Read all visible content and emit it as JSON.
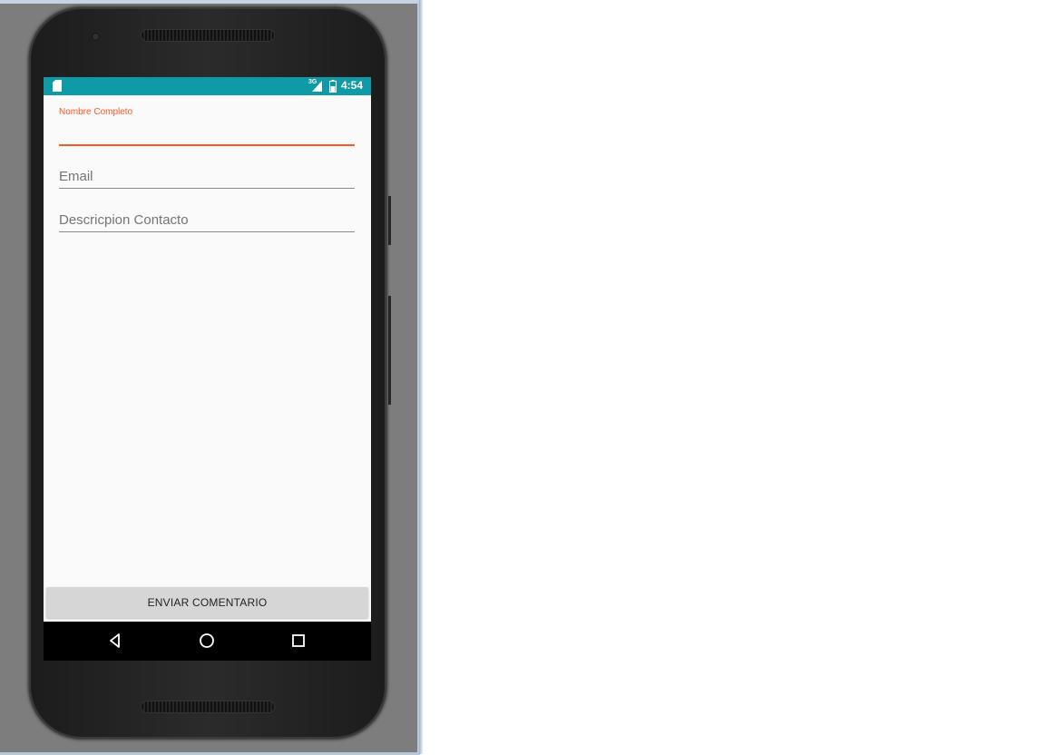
{
  "status_bar": {
    "network": "3G",
    "time": "4:54",
    "color": "#0e9aa7"
  },
  "form": {
    "name_field": {
      "label": "Nombre Completo",
      "value": ""
    },
    "email_field": {
      "placeholder": "Email",
      "value": ""
    },
    "description_field": {
      "placeholder": "Descricpion Contacto",
      "value": ""
    },
    "accent_color": "#ff5722"
  },
  "send_button": {
    "label": "ENVIAR COMENTARIO"
  },
  "nav_bar": {
    "icons": [
      "back-icon",
      "home-icon",
      "recents-icon"
    ]
  }
}
